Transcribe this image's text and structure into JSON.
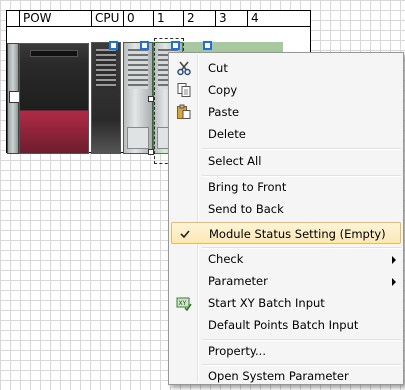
{
  "rack": {
    "headers": [
      "POW",
      "CPU",
      "0",
      "1",
      "2",
      "3",
      "4"
    ]
  },
  "context_menu": {
    "items": [
      {
        "label": "Cut",
        "icon": "scissors-icon"
      },
      {
        "label": "Copy",
        "icon": "copy-icon"
      },
      {
        "label": "Paste",
        "icon": "paste-icon"
      },
      {
        "label": "Delete"
      },
      {
        "label": "Select All"
      },
      {
        "label": "Bring to Front"
      },
      {
        "label": "Send to Back"
      },
      {
        "label": "Module Status Setting (Empty)",
        "checked": true,
        "icon": "checkmark-icon"
      },
      {
        "label": "Check",
        "submenu": true
      },
      {
        "label": "Parameter",
        "submenu": true
      },
      {
        "label": "Start XY Batch Input",
        "icon": "xy-batch-icon"
      },
      {
        "label": "Default Points Batch Input"
      },
      {
        "label": "Property..."
      },
      {
        "label": "Open System Parameter"
      }
    ],
    "colors": {
      "highlight_border": "#e3bd5c",
      "highlight_fill": "#fbe8b4",
      "handle_blue": "#1e73d2"
    }
  }
}
